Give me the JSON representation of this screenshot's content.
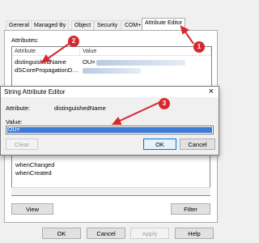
{
  "properties": {
    "tabs": [
      "General",
      "Managed By",
      "Object",
      "Security",
      "COM+",
      "Attribute Editor"
    ],
    "attributes_label": "Attributes:",
    "columns": [
      "Attribute",
      "Value"
    ],
    "rows": [
      {
        "attribute": "distinguishedName",
        "value": "OU="
      },
      {
        "attribute": "dSCorePropagationD…",
        "value": ""
      },
      {
        "attribute": "",
        "value": ""
      }
    ],
    "lower_rows": [
      "whenChanged",
      "whenCreated"
    ],
    "view_button": "View",
    "filter_button": "Filter",
    "ok_button": "OK",
    "cancel_button": "Cancel",
    "apply_button": "Apply",
    "help_button": "Help"
  },
  "editor": {
    "title": "String Attribute Editor",
    "close": "×",
    "attribute_label": "Attribute:",
    "attribute_value": "distinguishedName",
    "value_label": "Value:",
    "value_text": "OU=",
    "clear_button": "Clear",
    "ok_button": "OK",
    "cancel_button": "Cancel"
  },
  "annotations": {
    "one": "1",
    "two": "2",
    "three": "3",
    "color": "#d7282f"
  }
}
